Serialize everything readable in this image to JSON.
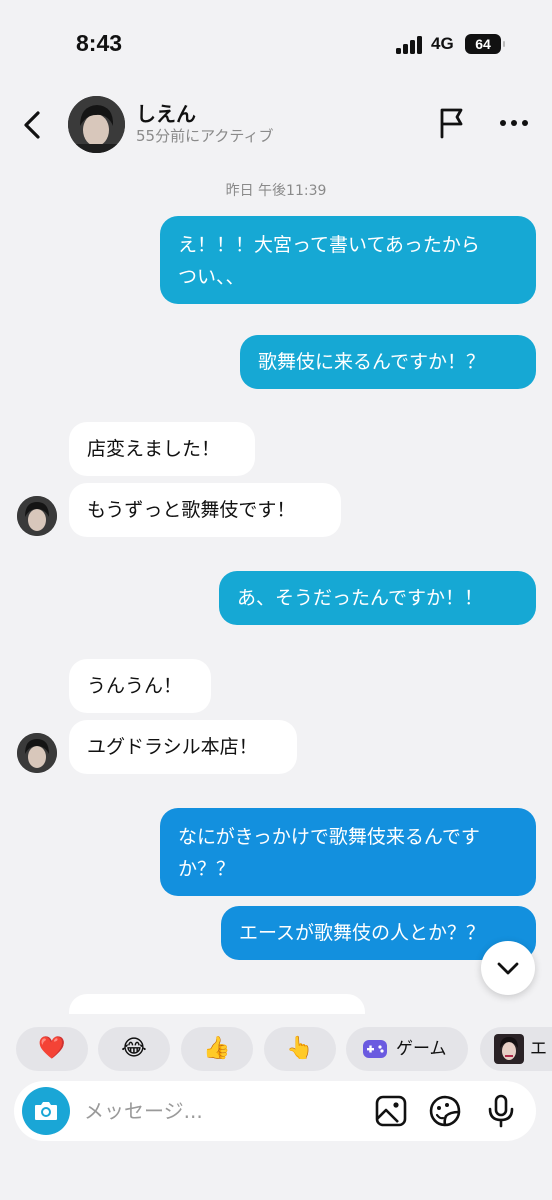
{
  "status_bar": {
    "time": "8:43",
    "network": "4G",
    "battery": "64"
  },
  "header": {
    "back_icon": "chevron-left-icon",
    "contact_name": "しえん",
    "contact_status": "55分前にアクティブ",
    "flag_icon": "flag-icon",
    "more_icon": "more-horizontal-icon"
  },
  "chat": {
    "timestamp": "昨日 午後11:39",
    "messages": [
      {
        "from": "me",
        "text_line1": "え！！！大宮って書いてあったから",
        "text_line2": "つい、、"
      },
      {
        "from": "me",
        "text": "歌舞伎に来るんですか！？"
      },
      {
        "from": "them",
        "text": "店変えました！"
      },
      {
        "from": "them",
        "text": "もうずっと歌舞伎です！"
      },
      {
        "from": "me",
        "text": "あ、そうだったんですか！！"
      },
      {
        "from": "them",
        "text": "うんうん！"
      },
      {
        "from": "them",
        "text": "ユグドラシル本店！"
      },
      {
        "from": "me",
        "text_line1": "なにがきっかけで歌舞伎来るんです",
        "text_line2": "か？？"
      },
      {
        "from": "me",
        "text": "エースが歌舞伎の人とか？？"
      }
    ]
  },
  "scroll_down_icon": "chevron-down-icon",
  "quick_chips": [
    {
      "icon": "heart-emoji",
      "glyph": "❤️"
    },
    {
      "icon": "laughing-tears-emoji",
      "glyph": "😂"
    },
    {
      "icon": "thumbs-up-emoji",
      "glyph": "👍"
    },
    {
      "icon": "pointing-hand-emoji",
      "glyph": "👆"
    },
    {
      "icon": "game-controller-icon",
      "label": "ゲーム"
    },
    {
      "icon": "avatar-thumbnail",
      "label": "エ"
    }
  ],
  "composer": {
    "camera_icon": "camera-icon",
    "placeholder": "メッセージ...",
    "image_icon": "image-icon",
    "sticker_icon": "sticker-icon",
    "mic_icon": "microphone-icon"
  },
  "colors": {
    "outgoing_bubble": "#16a8d4",
    "outgoing_bubble_bottom": "#1390de",
    "incoming_bubble": "#ffffff",
    "background": "#f2f2f4",
    "accent": "#1aa6d6"
  }
}
